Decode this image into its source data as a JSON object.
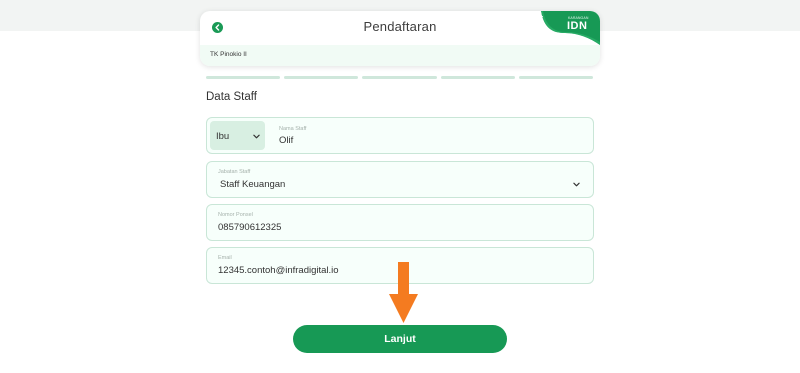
{
  "header": {
    "title": "Pendaftaran",
    "school": "TK Pinokio II",
    "brand": {
      "tagline": "KARANGAN",
      "name": "IDN"
    }
  },
  "progress": {
    "steps_total": 5
  },
  "section": {
    "title": "Data Staff"
  },
  "form": {
    "salutation": {
      "value": "Ibu"
    },
    "name": {
      "label": "Nama Staff",
      "value": "Olif"
    },
    "position": {
      "label": "Jabatan Staff",
      "value": "Staff Keuangan"
    },
    "phone": {
      "label": "Nomor Ponsel",
      "value": "085790612325"
    },
    "email": {
      "label": "Email",
      "value": "12345.contoh@infradigital.io"
    }
  },
  "cta": {
    "label": "Lanjut"
  },
  "colors": {
    "primary": "#179955",
    "annotation_arrow": "#f47b20"
  },
  "icons": [
    "back-arrow-icon",
    "brand-logo-icon",
    "chevron-down-icon",
    "annotation-arrow-icon"
  ]
}
